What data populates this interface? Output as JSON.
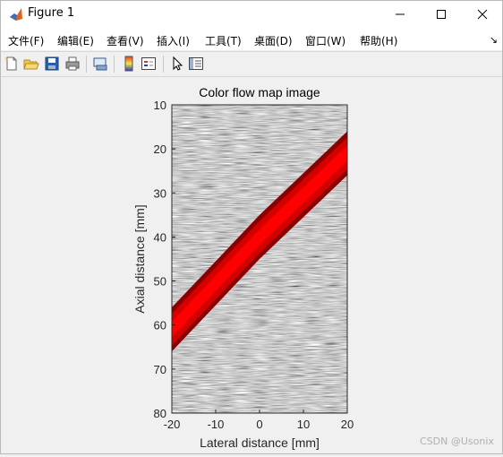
{
  "window": {
    "title": "Figure 1"
  },
  "menu": [
    "文件(F)",
    "编辑(E)",
    "查看(V)",
    "插入(I)",
    "工具(T)",
    "桌面(D)",
    "窗口(W)",
    "帮助(H)"
  ],
  "menu_overflow": "↘",
  "toolbar": [
    "new-figure-icon",
    "open-file-icon",
    "save-icon",
    "print-icon",
    "link-plot-icon",
    "colorbar-icon",
    "legend-icon",
    "pointer-icon",
    "property-editor-icon"
  ],
  "chart_data": {
    "type": "heatmap",
    "title": "Color flow map image",
    "xlabel": "Lateral distance [mm]",
    "ylabel": "Axial distance [mm]",
    "xlim": [
      -20,
      20
    ],
    "ylim": [
      10,
      80
    ],
    "y_reversed": true,
    "xticks": [
      "-20",
      "-10",
      "0",
      "10",
      "20"
    ],
    "yticks": [
      "10",
      "20",
      "30",
      "40",
      "50",
      "60",
      "70",
      "80"
    ],
    "background": "grayscale B-mode speckle",
    "flow_region": {
      "color": "#ff0000",
      "centerline": [
        [
          -20,
          61
        ],
        [
          0,
          40
        ],
        [
          20,
          21
        ]
      ],
      "half_width_mm": 5
    }
  },
  "watermark": "CSDN @Usonix"
}
